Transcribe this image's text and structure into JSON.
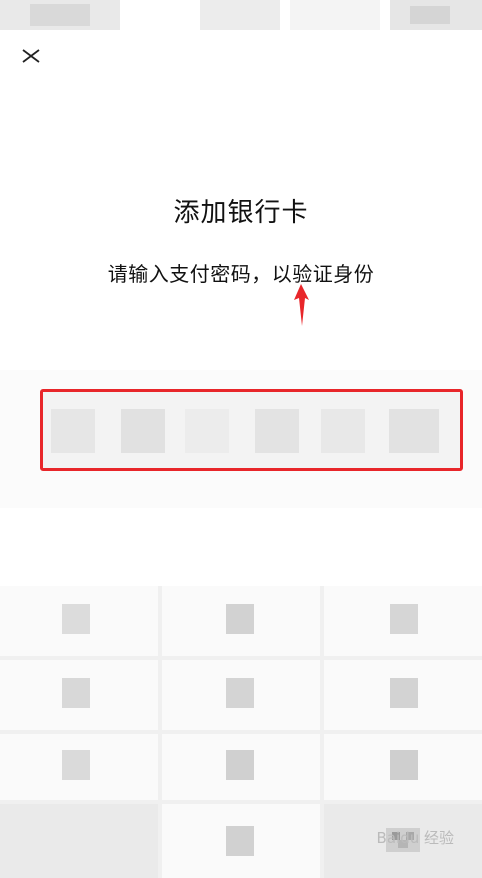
{
  "header": {
    "close_icon": "close-icon"
  },
  "page": {
    "title": "添加银行卡",
    "subtitle": "请输入支付密码，以验证身份"
  },
  "password": {
    "digits_entered": 0,
    "length": 6
  },
  "keypad": {
    "keys": [
      "1",
      "2",
      "3",
      "4",
      "5",
      "6",
      "7",
      "8",
      "9",
      "",
      "0",
      "delete"
    ]
  },
  "watermark": {
    "text": "Baidu 经验"
  },
  "colors": {
    "highlight_box": "#e8262a",
    "annotation_arrow": "#e8262a"
  }
}
